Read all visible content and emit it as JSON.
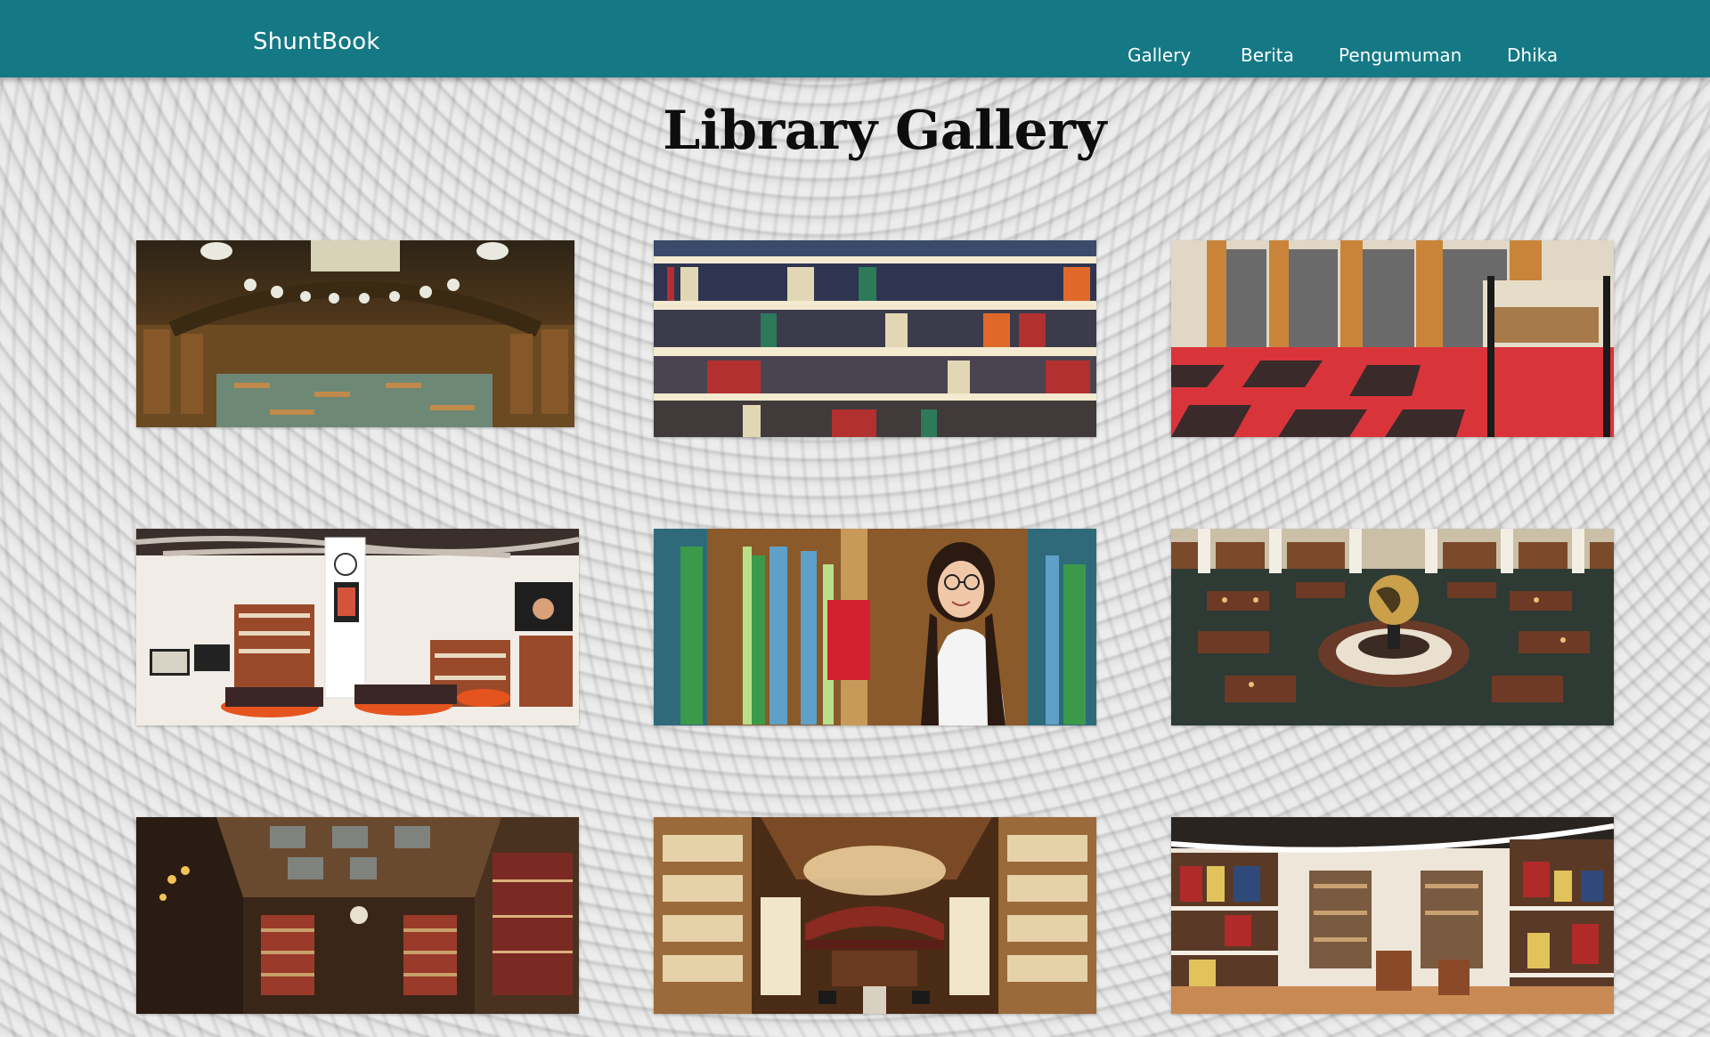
{
  "navbar": {
    "brand": "ShuntBook",
    "links": [
      "Gallery",
      "Berita",
      "Pengumuman",
      "Dhika"
    ]
  },
  "main": {
    "title": "Library Gallery"
  },
  "gallery": {
    "images": [
      {
        "name": "reading-hall-photo"
      },
      {
        "name": "bookshelf-closeup-photo"
      },
      {
        "name": "red-checkered-floor-library-photo"
      },
      {
        "name": "modern-lounge-library-photo"
      },
      {
        "name": "student-with-red-book-photo"
      },
      {
        "name": "globe-reading-room-photo"
      },
      {
        "name": "classic-wood-library-photo"
      },
      {
        "name": "ornate-bookstore-photo"
      },
      {
        "name": "curved-shelves-library-photo"
      }
    ]
  },
  "colors": {
    "navbar": "#147985",
    "nav_text": "#ffffff",
    "title_text": "#0d0d0d"
  }
}
